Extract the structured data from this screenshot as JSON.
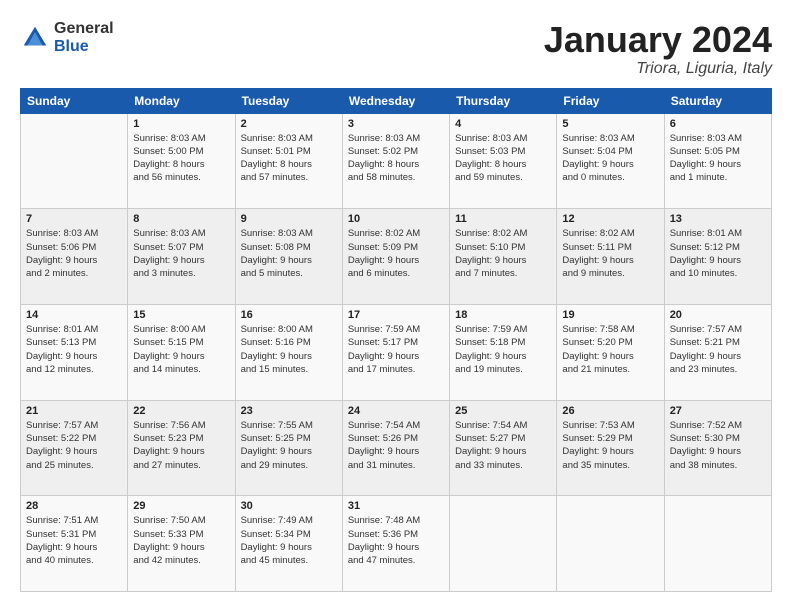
{
  "logo": {
    "general": "General",
    "blue": "Blue"
  },
  "title": "January 2024",
  "subtitle": "Triora, Liguria, Italy",
  "days_of_week": [
    "Sunday",
    "Monday",
    "Tuesday",
    "Wednesday",
    "Thursday",
    "Friday",
    "Saturday"
  ],
  "weeks": [
    [
      {
        "day": "",
        "info": ""
      },
      {
        "day": "1",
        "info": "Sunrise: 8:03 AM\nSunset: 5:00 PM\nDaylight: 8 hours\nand 56 minutes."
      },
      {
        "day": "2",
        "info": "Sunrise: 8:03 AM\nSunset: 5:01 PM\nDaylight: 8 hours\nand 57 minutes."
      },
      {
        "day": "3",
        "info": "Sunrise: 8:03 AM\nSunset: 5:02 PM\nDaylight: 8 hours\nand 58 minutes."
      },
      {
        "day": "4",
        "info": "Sunrise: 8:03 AM\nSunset: 5:03 PM\nDaylight: 8 hours\nand 59 minutes."
      },
      {
        "day": "5",
        "info": "Sunrise: 8:03 AM\nSunset: 5:04 PM\nDaylight: 9 hours\nand 0 minutes."
      },
      {
        "day": "6",
        "info": "Sunrise: 8:03 AM\nSunset: 5:05 PM\nDaylight: 9 hours\nand 1 minute."
      }
    ],
    [
      {
        "day": "7",
        "info": "Sunrise: 8:03 AM\nSunset: 5:06 PM\nDaylight: 9 hours\nand 2 minutes."
      },
      {
        "day": "8",
        "info": "Sunrise: 8:03 AM\nSunset: 5:07 PM\nDaylight: 9 hours\nand 3 minutes."
      },
      {
        "day": "9",
        "info": "Sunrise: 8:03 AM\nSunset: 5:08 PM\nDaylight: 9 hours\nand 5 minutes."
      },
      {
        "day": "10",
        "info": "Sunrise: 8:02 AM\nSunset: 5:09 PM\nDaylight: 9 hours\nand 6 minutes."
      },
      {
        "day": "11",
        "info": "Sunrise: 8:02 AM\nSunset: 5:10 PM\nDaylight: 9 hours\nand 7 minutes."
      },
      {
        "day": "12",
        "info": "Sunrise: 8:02 AM\nSunset: 5:11 PM\nDaylight: 9 hours\nand 9 minutes."
      },
      {
        "day": "13",
        "info": "Sunrise: 8:01 AM\nSunset: 5:12 PM\nDaylight: 9 hours\nand 10 minutes."
      }
    ],
    [
      {
        "day": "14",
        "info": "Sunrise: 8:01 AM\nSunset: 5:13 PM\nDaylight: 9 hours\nand 12 minutes."
      },
      {
        "day": "15",
        "info": "Sunrise: 8:00 AM\nSunset: 5:15 PM\nDaylight: 9 hours\nand 14 minutes."
      },
      {
        "day": "16",
        "info": "Sunrise: 8:00 AM\nSunset: 5:16 PM\nDaylight: 9 hours\nand 15 minutes."
      },
      {
        "day": "17",
        "info": "Sunrise: 7:59 AM\nSunset: 5:17 PM\nDaylight: 9 hours\nand 17 minutes."
      },
      {
        "day": "18",
        "info": "Sunrise: 7:59 AM\nSunset: 5:18 PM\nDaylight: 9 hours\nand 19 minutes."
      },
      {
        "day": "19",
        "info": "Sunrise: 7:58 AM\nSunset: 5:20 PM\nDaylight: 9 hours\nand 21 minutes."
      },
      {
        "day": "20",
        "info": "Sunrise: 7:57 AM\nSunset: 5:21 PM\nDaylight: 9 hours\nand 23 minutes."
      }
    ],
    [
      {
        "day": "21",
        "info": "Sunrise: 7:57 AM\nSunset: 5:22 PM\nDaylight: 9 hours\nand 25 minutes."
      },
      {
        "day": "22",
        "info": "Sunrise: 7:56 AM\nSunset: 5:23 PM\nDaylight: 9 hours\nand 27 minutes."
      },
      {
        "day": "23",
        "info": "Sunrise: 7:55 AM\nSunset: 5:25 PM\nDaylight: 9 hours\nand 29 minutes."
      },
      {
        "day": "24",
        "info": "Sunrise: 7:54 AM\nSunset: 5:26 PM\nDaylight: 9 hours\nand 31 minutes."
      },
      {
        "day": "25",
        "info": "Sunrise: 7:54 AM\nSunset: 5:27 PM\nDaylight: 9 hours\nand 33 minutes."
      },
      {
        "day": "26",
        "info": "Sunrise: 7:53 AM\nSunset: 5:29 PM\nDaylight: 9 hours\nand 35 minutes."
      },
      {
        "day": "27",
        "info": "Sunrise: 7:52 AM\nSunset: 5:30 PM\nDaylight: 9 hours\nand 38 minutes."
      }
    ],
    [
      {
        "day": "28",
        "info": "Sunrise: 7:51 AM\nSunset: 5:31 PM\nDaylight: 9 hours\nand 40 minutes."
      },
      {
        "day": "29",
        "info": "Sunrise: 7:50 AM\nSunset: 5:33 PM\nDaylight: 9 hours\nand 42 minutes."
      },
      {
        "day": "30",
        "info": "Sunrise: 7:49 AM\nSunset: 5:34 PM\nDaylight: 9 hours\nand 45 minutes."
      },
      {
        "day": "31",
        "info": "Sunrise: 7:48 AM\nSunset: 5:36 PM\nDaylight: 9 hours\nand 47 minutes."
      },
      {
        "day": "",
        "info": ""
      },
      {
        "day": "",
        "info": ""
      },
      {
        "day": "",
        "info": ""
      }
    ]
  ]
}
